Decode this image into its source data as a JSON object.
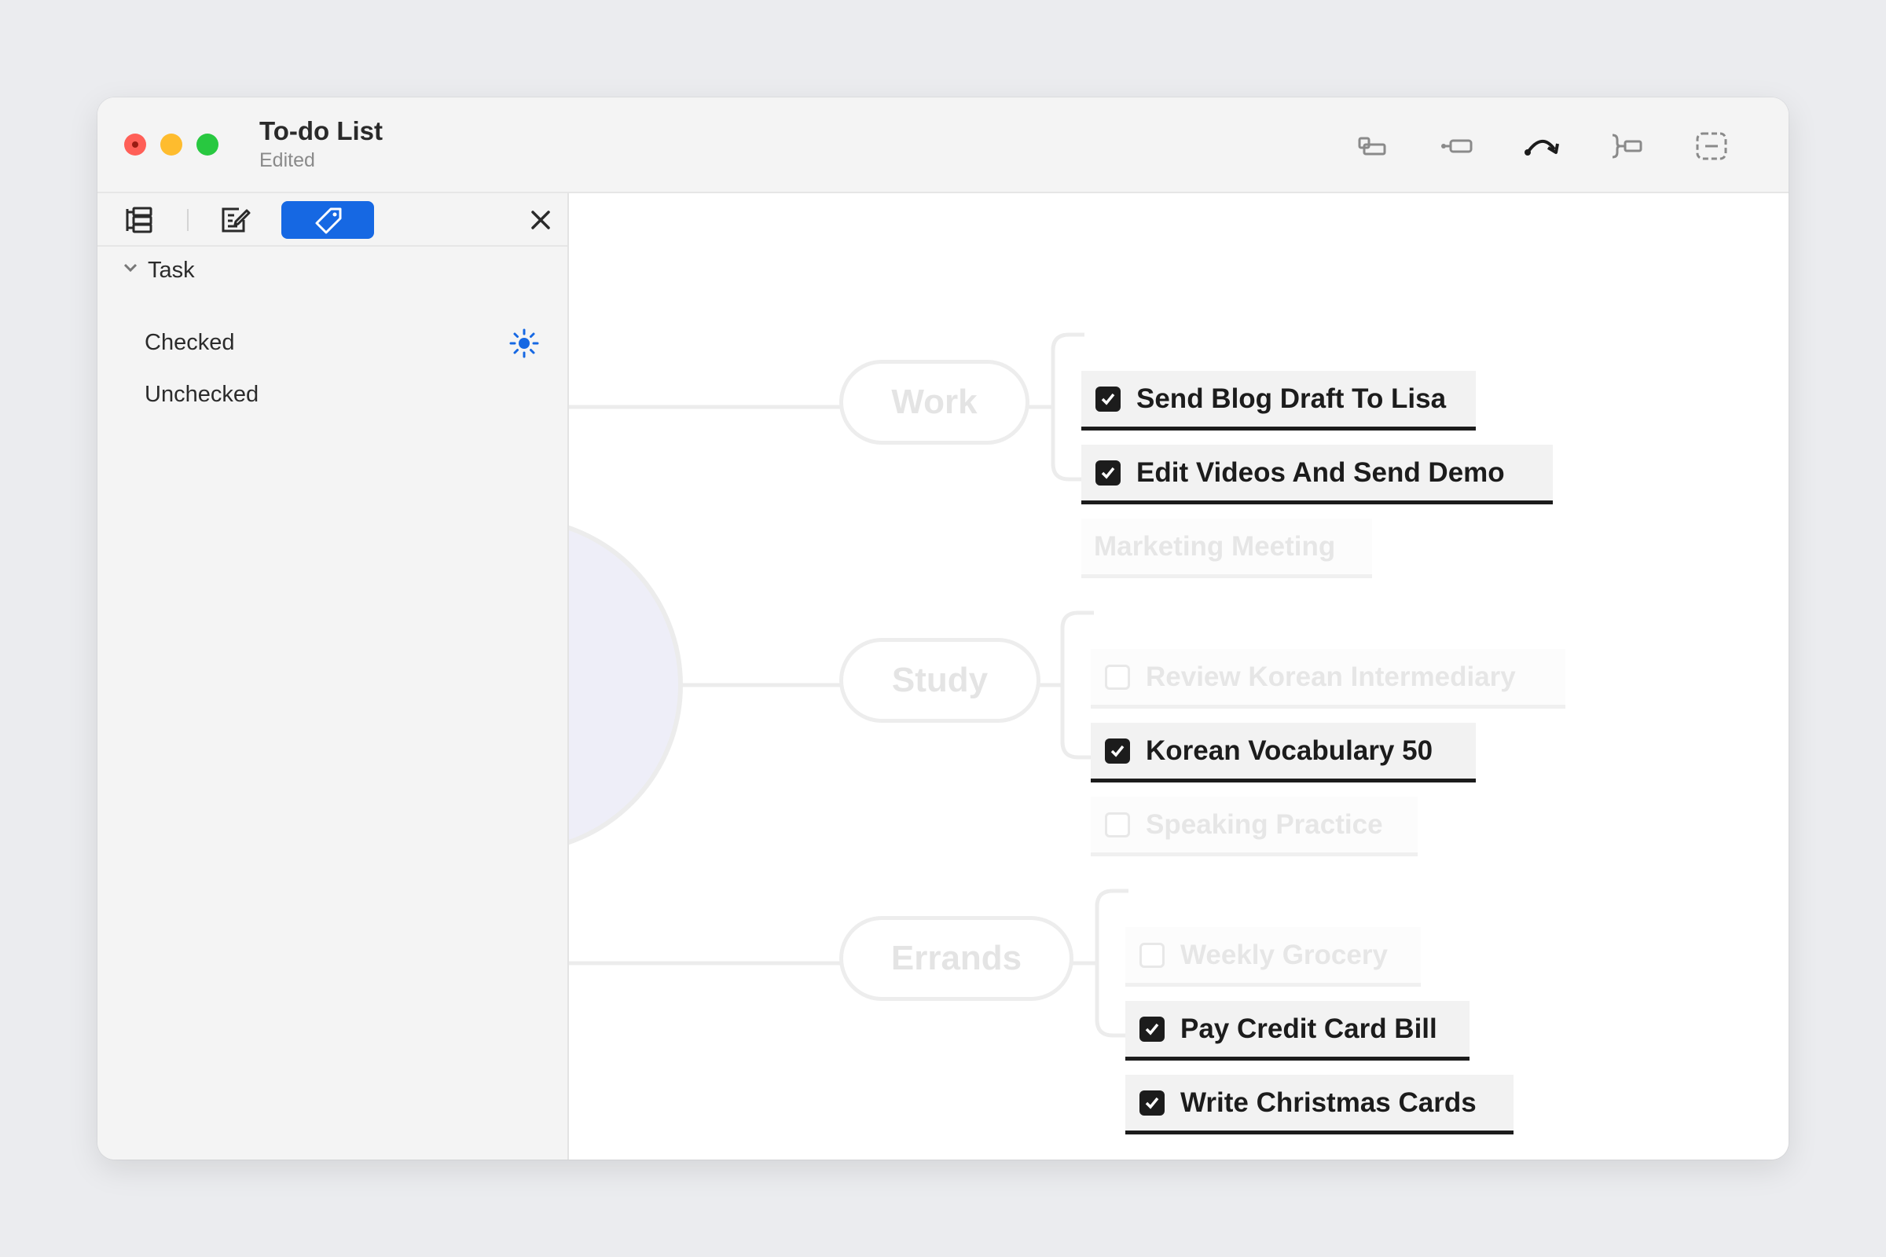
{
  "window": {
    "title": "To-do List",
    "subtitle": "Edited"
  },
  "toolbar": {
    "icons": [
      "subtopic-icon",
      "topic-icon",
      "relationship-icon",
      "summary-icon",
      "boundary-icon"
    ]
  },
  "sidebar": {
    "tabs": [
      {
        "icon": "outline-icon",
        "active": false
      },
      {
        "icon": "note-edit-icon",
        "active": false
      },
      {
        "icon": "tag-icon",
        "active": true
      }
    ],
    "group": "Task",
    "items": [
      {
        "label": "Checked",
        "highlight_icon": "sun-icon"
      },
      {
        "label": "Unchecked"
      }
    ]
  },
  "mindmap": {
    "branches": [
      {
        "label": "Work",
        "tasks": [
          {
            "label": "Send Blog Draft To Lisa",
            "checked": true,
            "highlighted": true
          },
          {
            "label": "Edit Videos And Send Demo",
            "checked": true,
            "highlighted": true
          },
          {
            "label": "Marketing Meeting",
            "checked": null,
            "highlighted": false
          }
        ]
      },
      {
        "label": "Study",
        "tasks": [
          {
            "label": "Review Korean Intermediary",
            "checked": false,
            "highlighted": false
          },
          {
            "label": "Korean Vocabulary 50",
            "checked": true,
            "highlighted": true
          },
          {
            "label": "Speaking Practice",
            "checked": false,
            "highlighted": false
          }
        ]
      },
      {
        "label": "Errands",
        "tasks": [
          {
            "label": "Weekly Grocery",
            "checked": false,
            "highlighted": false
          },
          {
            "label": "Pay Credit Card Bill",
            "checked": true,
            "highlighted": true
          },
          {
            "label": "Write Christmas Cards",
            "checked": true,
            "highlighted": true
          }
        ]
      }
    ]
  },
  "colors": {
    "accent": "#1668e3",
    "checked_text": "#1c1c1c",
    "dimmed": "#e6e6e6"
  }
}
